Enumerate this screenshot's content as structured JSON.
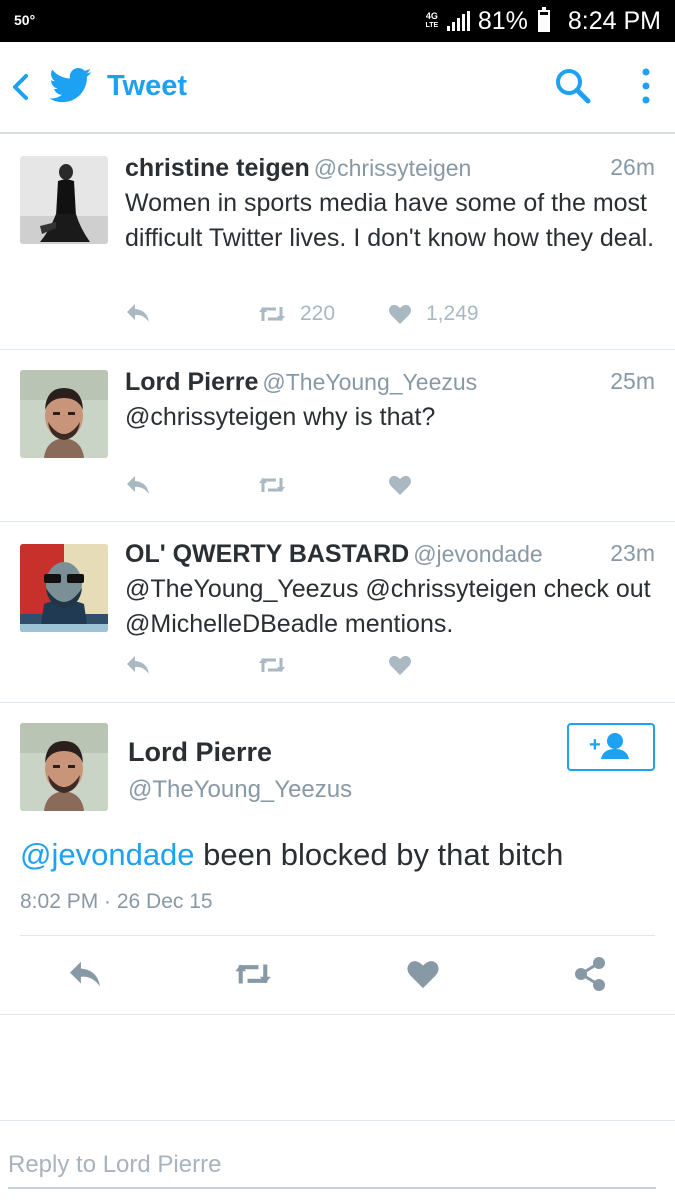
{
  "status_bar": {
    "temperature": "50°",
    "network": "4G",
    "network_sub": "LTE",
    "battery": "81%",
    "battery_level": 0.81,
    "time": "8:24 PM"
  },
  "header": {
    "title": "Tweet",
    "back_icon": "chevron-left-icon",
    "logo_icon": "twitter-bird-icon",
    "search_icon": "search-icon",
    "more_icon": "more-vertical-icon"
  },
  "tweets": [
    {
      "name": "christine teigen",
      "handle": "@chrissyteigen",
      "time": "26m",
      "text": "Women in sports media have some of the most difficult Twitter lives. I don't know how they deal.",
      "retweets": "220",
      "likes": "1,249"
    },
    {
      "name": "Lord Pierre",
      "handle": "@TheYoung_Yeezus",
      "time": "25m",
      "text": "@chrissyteigen why is that?",
      "retweets": "",
      "likes": ""
    },
    {
      "name": "OL' QWERTY BASTARD",
      "handle": "@jevondade",
      "time": "23m",
      "text": "@TheYoung_Yeezus @chrissyteigen check out @MichelleDBeadle mentions.",
      "retweets": "",
      "likes": ""
    }
  ],
  "detail": {
    "name": "Lord Pierre",
    "handle": "@TheYoung_Yeezus",
    "mention": "@jevondade",
    "text": " been blocked by that bitch",
    "timestamp": "8:02 PM · 26 Dec 15",
    "follow_icon": "add-user-icon"
  },
  "reply": {
    "placeholder": "Reply to Lord Pierre"
  },
  "colors": {
    "accent": "#1da1f2",
    "muted": "#8899a6",
    "icon_gray": "#aab8c2",
    "text": "#292f33"
  }
}
